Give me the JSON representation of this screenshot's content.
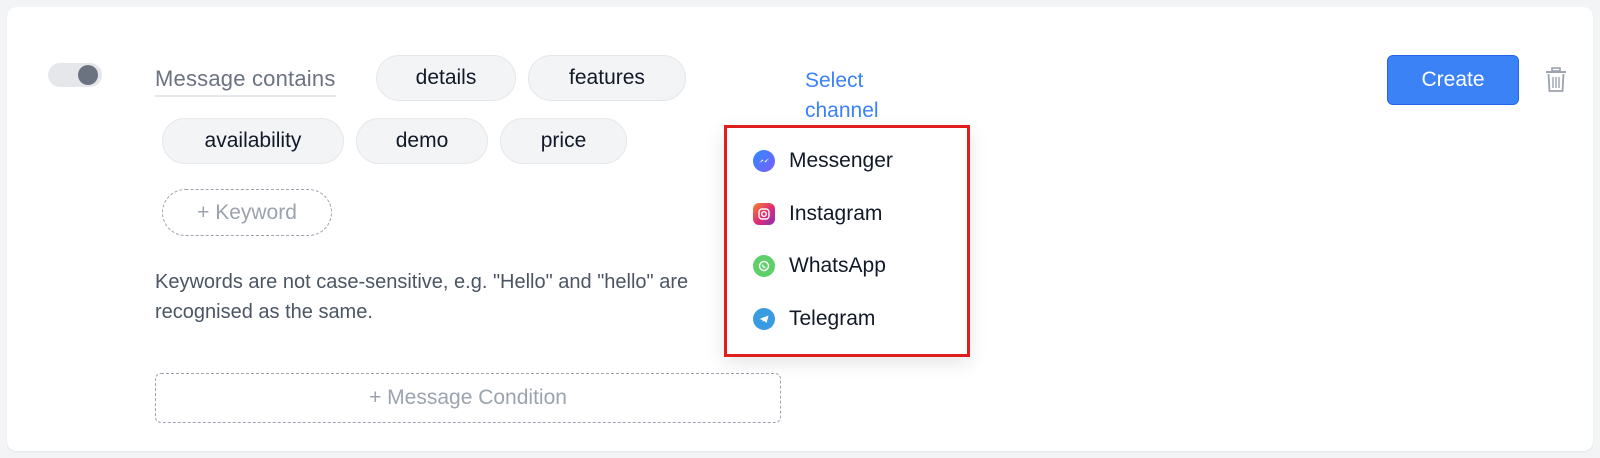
{
  "condition": {
    "toggle_on": true,
    "label": "Message contains",
    "keywords": [
      "details",
      "features",
      "availability",
      "demo",
      "price"
    ],
    "add_keyword_label": "+ Keyword",
    "hint": "Keywords are not case-sensitive, e.g. \"Hello\" and \"hello\" are recognised as the same.",
    "add_condition_label": "+ Message Condition"
  },
  "channel": {
    "select_label": "Select channel",
    "options": [
      {
        "label": "Messenger",
        "icon": "messenger-icon"
      },
      {
        "label": "Instagram",
        "icon": "instagram-icon"
      },
      {
        "label": "WhatsApp",
        "icon": "whatsapp-icon"
      },
      {
        "label": "Telegram",
        "icon": "telegram-icon"
      }
    ]
  },
  "actions": {
    "create_label": "Create",
    "delete_icon": "trash-icon"
  },
  "colors": {
    "accent": "#3b82f6",
    "highlight_border": "#e01e1e"
  }
}
